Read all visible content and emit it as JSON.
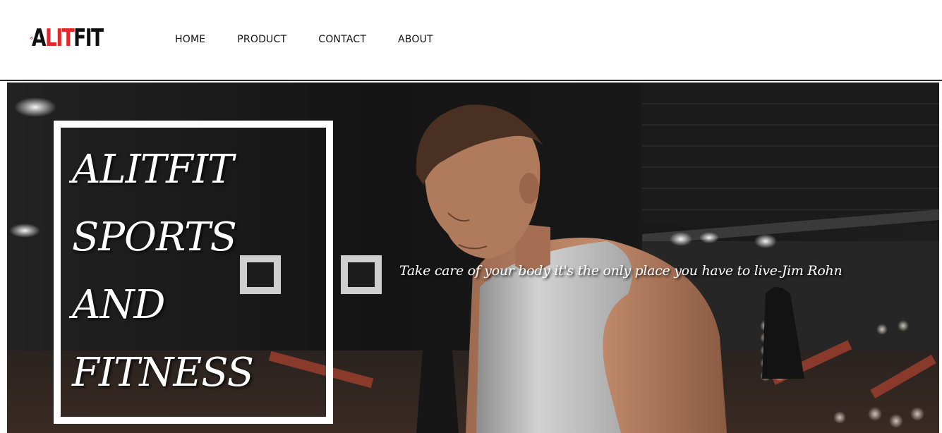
{
  "brand": {
    "logo_text_dark": "A",
    "logo_text_red": "LIT",
    "logo_text_end": "FIT",
    "accent_color": "#e32626"
  },
  "nav": {
    "items": [
      {
        "label": "HOME"
      },
      {
        "label": "PRODUCT"
      },
      {
        "label": "CONTACT"
      },
      {
        "label": "ABOUT"
      }
    ]
  },
  "hero": {
    "title_lines": [
      "ALITFIT",
      "SPORTS",
      "AND",
      "FITNESS"
    ],
    "quote": "Take care of your body it's the only place you have to live-Jim Rohn",
    "image_icon": "gym-athlete-photo"
  }
}
